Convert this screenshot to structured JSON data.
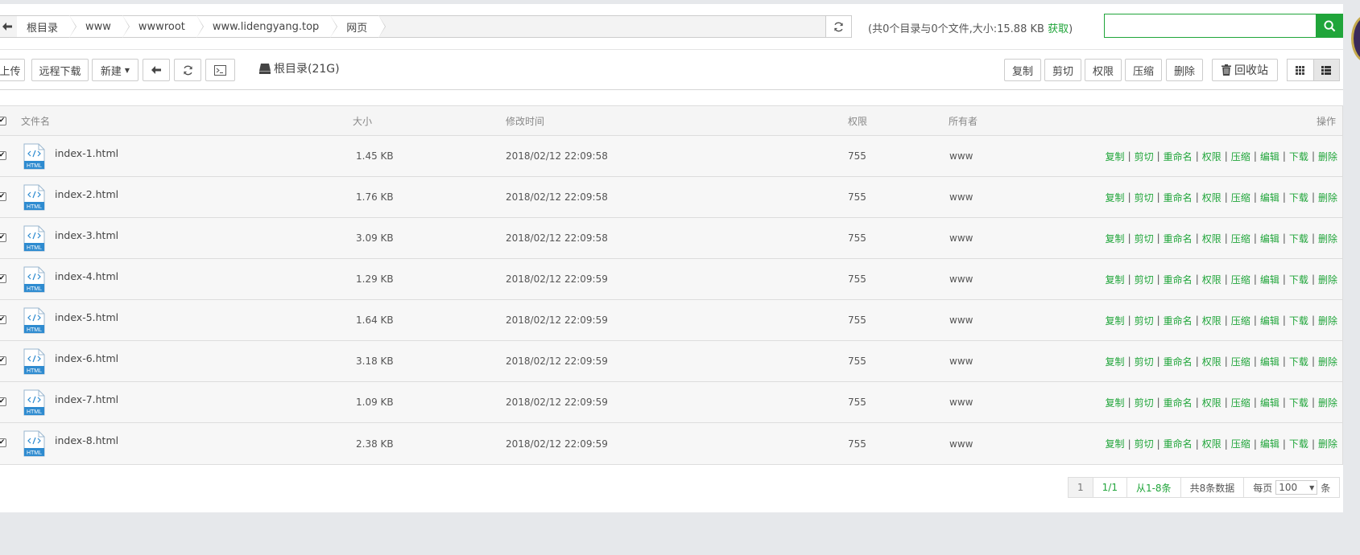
{
  "breadcrumb": {
    "items": [
      "根目录",
      "www",
      "wwwroot",
      "www.lidengyang.top",
      "网页"
    ]
  },
  "summary": {
    "text": "(共0个目录与0个文件,大小:15.88 KB ",
    "link": "获取",
    "suffix": ")"
  },
  "search": {
    "value": "",
    "placeholder": ""
  },
  "toolbar": {
    "upload": "上传",
    "remote_download": "远程下载",
    "new": "新建",
    "disk_label": "根目录(21G)",
    "copy": "复制",
    "cut": "剪切",
    "permission": "权限",
    "compress": "压缩",
    "delete": "删除",
    "recycle": "回收站"
  },
  "table": {
    "headers": {
      "name": "文件名",
      "size": "大小",
      "mtime": "修改时间",
      "perm": "权限",
      "owner": "所有者",
      "ops": "操作"
    },
    "rows": [
      {
        "name": "index-1.html",
        "size": "1.45 KB",
        "mtime": "2018/02/12 22:09:58",
        "perm": "755",
        "owner": "www"
      },
      {
        "name": "index-2.html",
        "size": "1.76 KB",
        "mtime": "2018/02/12 22:09:58",
        "perm": "755",
        "owner": "www"
      },
      {
        "name": "index-3.html",
        "size": "3.09 KB",
        "mtime": "2018/02/12 22:09:58",
        "perm": "755",
        "owner": "www"
      },
      {
        "name": "index-4.html",
        "size": "1.29 KB",
        "mtime": "2018/02/12 22:09:59",
        "perm": "755",
        "owner": "www"
      },
      {
        "name": "index-5.html",
        "size": "1.64 KB",
        "mtime": "2018/02/12 22:09:59",
        "perm": "755",
        "owner": "www"
      },
      {
        "name": "index-6.html",
        "size": "3.18 KB",
        "mtime": "2018/02/12 22:09:59",
        "perm": "755",
        "owner": "www"
      },
      {
        "name": "index-7.html",
        "size": "1.09 KB",
        "mtime": "2018/02/12 22:09:59",
        "perm": "755",
        "owner": "www"
      },
      {
        "name": "index-8.html",
        "size": "2.38 KB",
        "mtime": "2018/02/12 22:09:59",
        "perm": "755",
        "owner": "www"
      }
    ],
    "row_ops": [
      "复制",
      "剪切",
      "重命名",
      "权限",
      "压缩",
      "编辑",
      "下载",
      "删除"
    ],
    "icon_label": "HTML"
  },
  "pager": {
    "current": "1",
    "pages": "1/1",
    "range": "从1-8条",
    "total": "共8条数据",
    "per_page_label": "每页",
    "per_page_value": "100",
    "unit": "条"
  },
  "colors": {
    "accent": "#20a53a"
  }
}
